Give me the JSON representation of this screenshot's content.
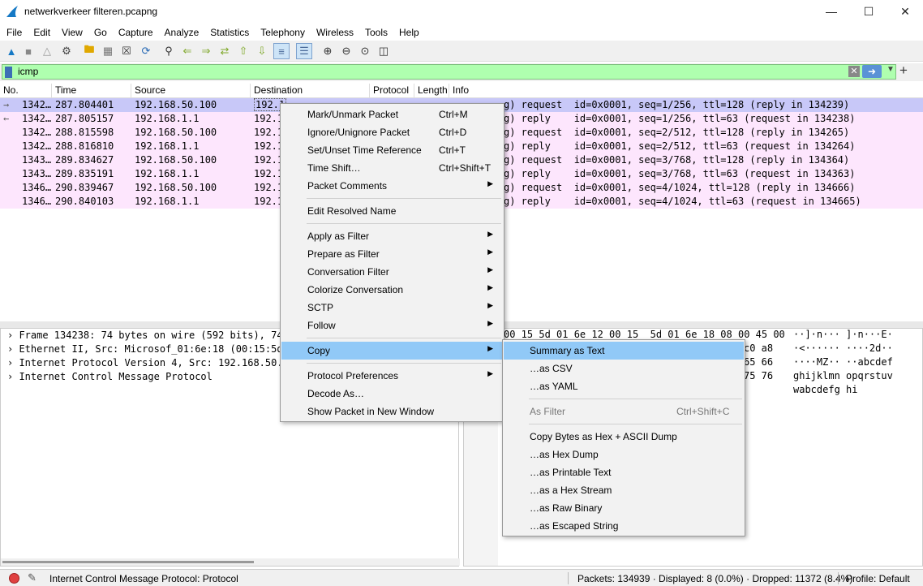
{
  "window": {
    "title": "netwerkverkeer filteren.pcapng"
  },
  "menubar": [
    "File",
    "Edit",
    "View",
    "Go",
    "Capture",
    "Analyze",
    "Statistics",
    "Telephony",
    "Wireless",
    "Tools",
    "Help"
  ],
  "filter": {
    "value": "icmp",
    "color": "#afffaf"
  },
  "packet_list": {
    "columns": [
      "No.",
      "Time",
      "Source",
      "Destination",
      "Protocol",
      "Length",
      "Info"
    ],
    "rows": [
      {
        "no": "1342…",
        "time": "287.804401",
        "source": "192.168.50.100",
        "dest": "192.1",
        "info": "g) request  id=0x0001, seq=1/256, ttl=128 (reply in 134239)",
        "selected": true
      },
      {
        "no": "1342…",
        "time": "287.805157",
        "source": "192.168.1.1",
        "dest": "192.1",
        "info": "g) reply    id=0x0001, seq=1/256, ttl=63 (request in 134238)"
      },
      {
        "no": "1342…",
        "time": "288.815598",
        "source": "192.168.50.100",
        "dest": "192.1",
        "info": "g) request  id=0x0001, seq=2/512, ttl=128 (reply in 134265)"
      },
      {
        "no": "1342…",
        "time": "288.816810",
        "source": "192.168.1.1",
        "dest": "192.1",
        "info": "g) reply    id=0x0001, seq=2/512, ttl=63 (request in 134264)"
      },
      {
        "no": "1343…",
        "time": "289.834627",
        "source": "192.168.50.100",
        "dest": "192.1",
        "info": "g) request  id=0x0001, seq=3/768, ttl=128 (reply in 134364)"
      },
      {
        "no": "1343…",
        "time": "289.835191",
        "source": "192.168.1.1",
        "dest": "192.1",
        "info": "g) reply    id=0x0001, seq=3/768, ttl=63 (request in 134363)"
      },
      {
        "no": "1346…",
        "time": "290.839467",
        "source": "192.168.50.100",
        "dest": "192.1",
        "info": "g) request  id=0x0001, seq=4/1024, ttl=128 (reply in 134666)"
      },
      {
        "no": "1346…",
        "time": "290.840103",
        "source": "192.168.1.1",
        "dest": "192.1",
        "info": "g) reply    id=0x0001, seq=4/1024, ttl=63 (request in 134665)"
      }
    ],
    "row_color": "#fde6fd",
    "selected_color": "#c8c8f8"
  },
  "details": [
    "Frame 134238: 74 bytes on wire (592 bits), 74",
    "Ethernet II, Src: Microsof_01:6e:18 (00:15:5d:",
    "Internet Protocol Version 4, Src: 192.168.50.1",
    "Internet Control Message Protocol"
  ],
  "bytes": {
    "hex": [
      "00 15 5d 01 6e 12 00 15  5d 01 6e 18 08 00 45 00",
      "c0 a8",
      "65 66",
      "75 76"
    ],
    "ascii": [
      "··]·n··· ]·n···E·",
      "·<······ ····2d··",
      "····MZ·· ··abcdef",
      "ghijklmn opqrstuv",
      "wabcdefg hi"
    ]
  },
  "context_menu": {
    "items": [
      {
        "label": "Mark/Unmark Packet",
        "shortcut": "Ctrl+M"
      },
      {
        "label": "Ignore/Unignore Packet",
        "shortcut": "Ctrl+D"
      },
      {
        "label": "Set/Unset Time Reference",
        "shortcut": "Ctrl+T"
      },
      {
        "label": "Time Shift…",
        "shortcut": "Ctrl+Shift+T"
      },
      {
        "label": "Packet Comments"
      },
      {
        "label": "Edit Resolved Name"
      },
      {
        "label": "Apply as Filter"
      },
      {
        "label": "Prepare as Filter"
      },
      {
        "label": "Conversation Filter"
      },
      {
        "label": "Colorize Conversation"
      },
      {
        "label": "SCTP"
      },
      {
        "label": "Follow"
      },
      {
        "label": "Copy"
      },
      {
        "label": "Protocol Preferences"
      },
      {
        "label": "Decode As…"
      },
      {
        "label": "Show Packet in New Window"
      }
    ]
  },
  "copy_submenu": {
    "items": [
      {
        "label": "Summary as Text"
      },
      {
        "label": "…as CSV"
      },
      {
        "label": "…as YAML"
      },
      {
        "label": "As Filter",
        "shortcut": "Ctrl+Shift+C"
      },
      {
        "label": "Copy Bytes as Hex + ASCII Dump"
      },
      {
        "label": "…as Hex Dump"
      },
      {
        "label": "…as Printable Text"
      },
      {
        "label": "…as a Hex Stream"
      },
      {
        "label": "…as Raw Binary"
      },
      {
        "label": "…as Escaped String"
      }
    ]
  },
  "statusbar": {
    "protocol": "Internet Control Message Protocol: Protocol",
    "packets": "Packets: 134939 · Displayed: 8 (0.0%) · Dropped: 11372 (8.4%)",
    "profile": "Profile: Default"
  }
}
